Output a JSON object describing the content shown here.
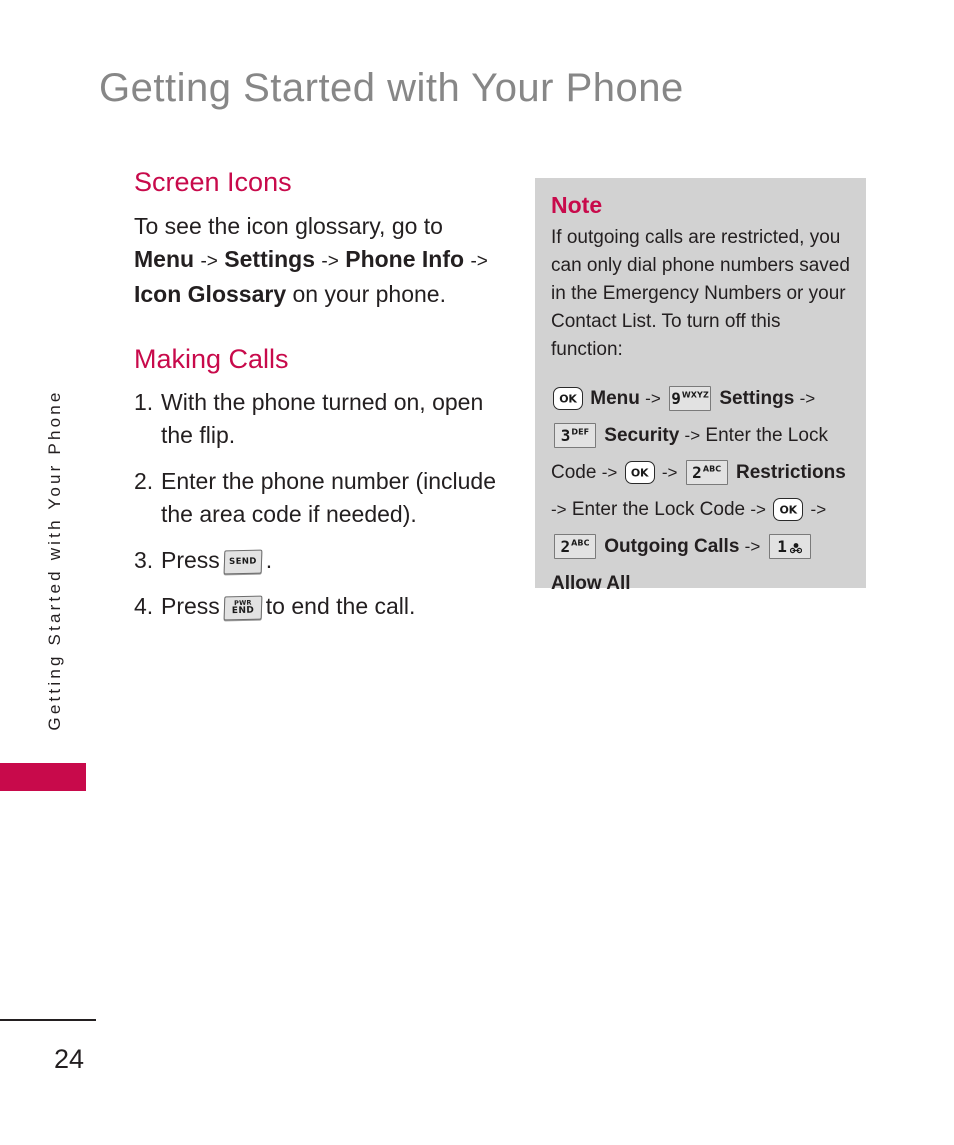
{
  "page": {
    "title": "Getting Started with Your Phone",
    "side_tab_text": "Getting Started with Your Phone",
    "number": "24",
    "accent_color": "#c80a4b",
    "title_color": "#878787",
    "note_bg_color": "#d2d2d2"
  },
  "screen_icons": {
    "heading": "Screen Icons",
    "text_1": "To see the icon glossary, go to",
    "bold_menu": "Menu",
    "arrow_1": "->",
    "bold_settings": "Settings",
    "arrow_2": "->",
    "bold_phone_info": "Phone Info",
    "arrow_3": "->",
    "bold_icon_glossary": "Icon Glossary",
    "text_2": "on your phone."
  },
  "making_calls": {
    "heading": "Making Calls",
    "steps": [
      {
        "num": "1.",
        "text": "With the phone turned on, open the flip."
      },
      {
        "num": "2.",
        "text": "Enter the phone number (include the area code if needed)."
      },
      {
        "num": "3.",
        "pre": "Press",
        "key": "SEND",
        "post": "."
      },
      {
        "num": "4.",
        "pre": "Press",
        "key_line1": "PWR",
        "key_line2": "END",
        "post": "to end the call."
      }
    ]
  },
  "note": {
    "title": "Note",
    "body": "If outgoing calls are restricted, you can only dial phone numbers saved in the Emergency Numbers or your Contact List. To turn off this function:",
    "sequence": {
      "key_ok_1": "OK",
      "label_menu": "Menu",
      "arrow_1": "->",
      "key_9_digit": "9",
      "key_9_letters": "WXYZ",
      "label_settings": "Settings",
      "arrow_2": "->",
      "key_3_digit": "3",
      "key_3_letters": "DEF",
      "label_security": "Security",
      "arrow_3": "->",
      "label_enter_lock_code_1": "Enter the Lock Code",
      "arrow_4": "->",
      "key_ok_2": "OK",
      "arrow_5": "->",
      "key_2_digit": "2",
      "key_2_letters": "ABC",
      "label_restrictions": "Restrictions",
      "arrow_6": "->",
      "label_enter_lock_code_2": "Enter the Lock Code",
      "arrow_7": "->",
      "key_ok_3": "OK",
      "arrow_8": "->",
      "key_2b_digit": "2",
      "key_2b_letters": "ABC",
      "label_outgoing_calls": "Outgoing Calls",
      "arrow_9": "->",
      "key_1_digit": "1",
      "key_1_icon": "voicemail-icon",
      "label_allow_all": "Allow All"
    }
  }
}
